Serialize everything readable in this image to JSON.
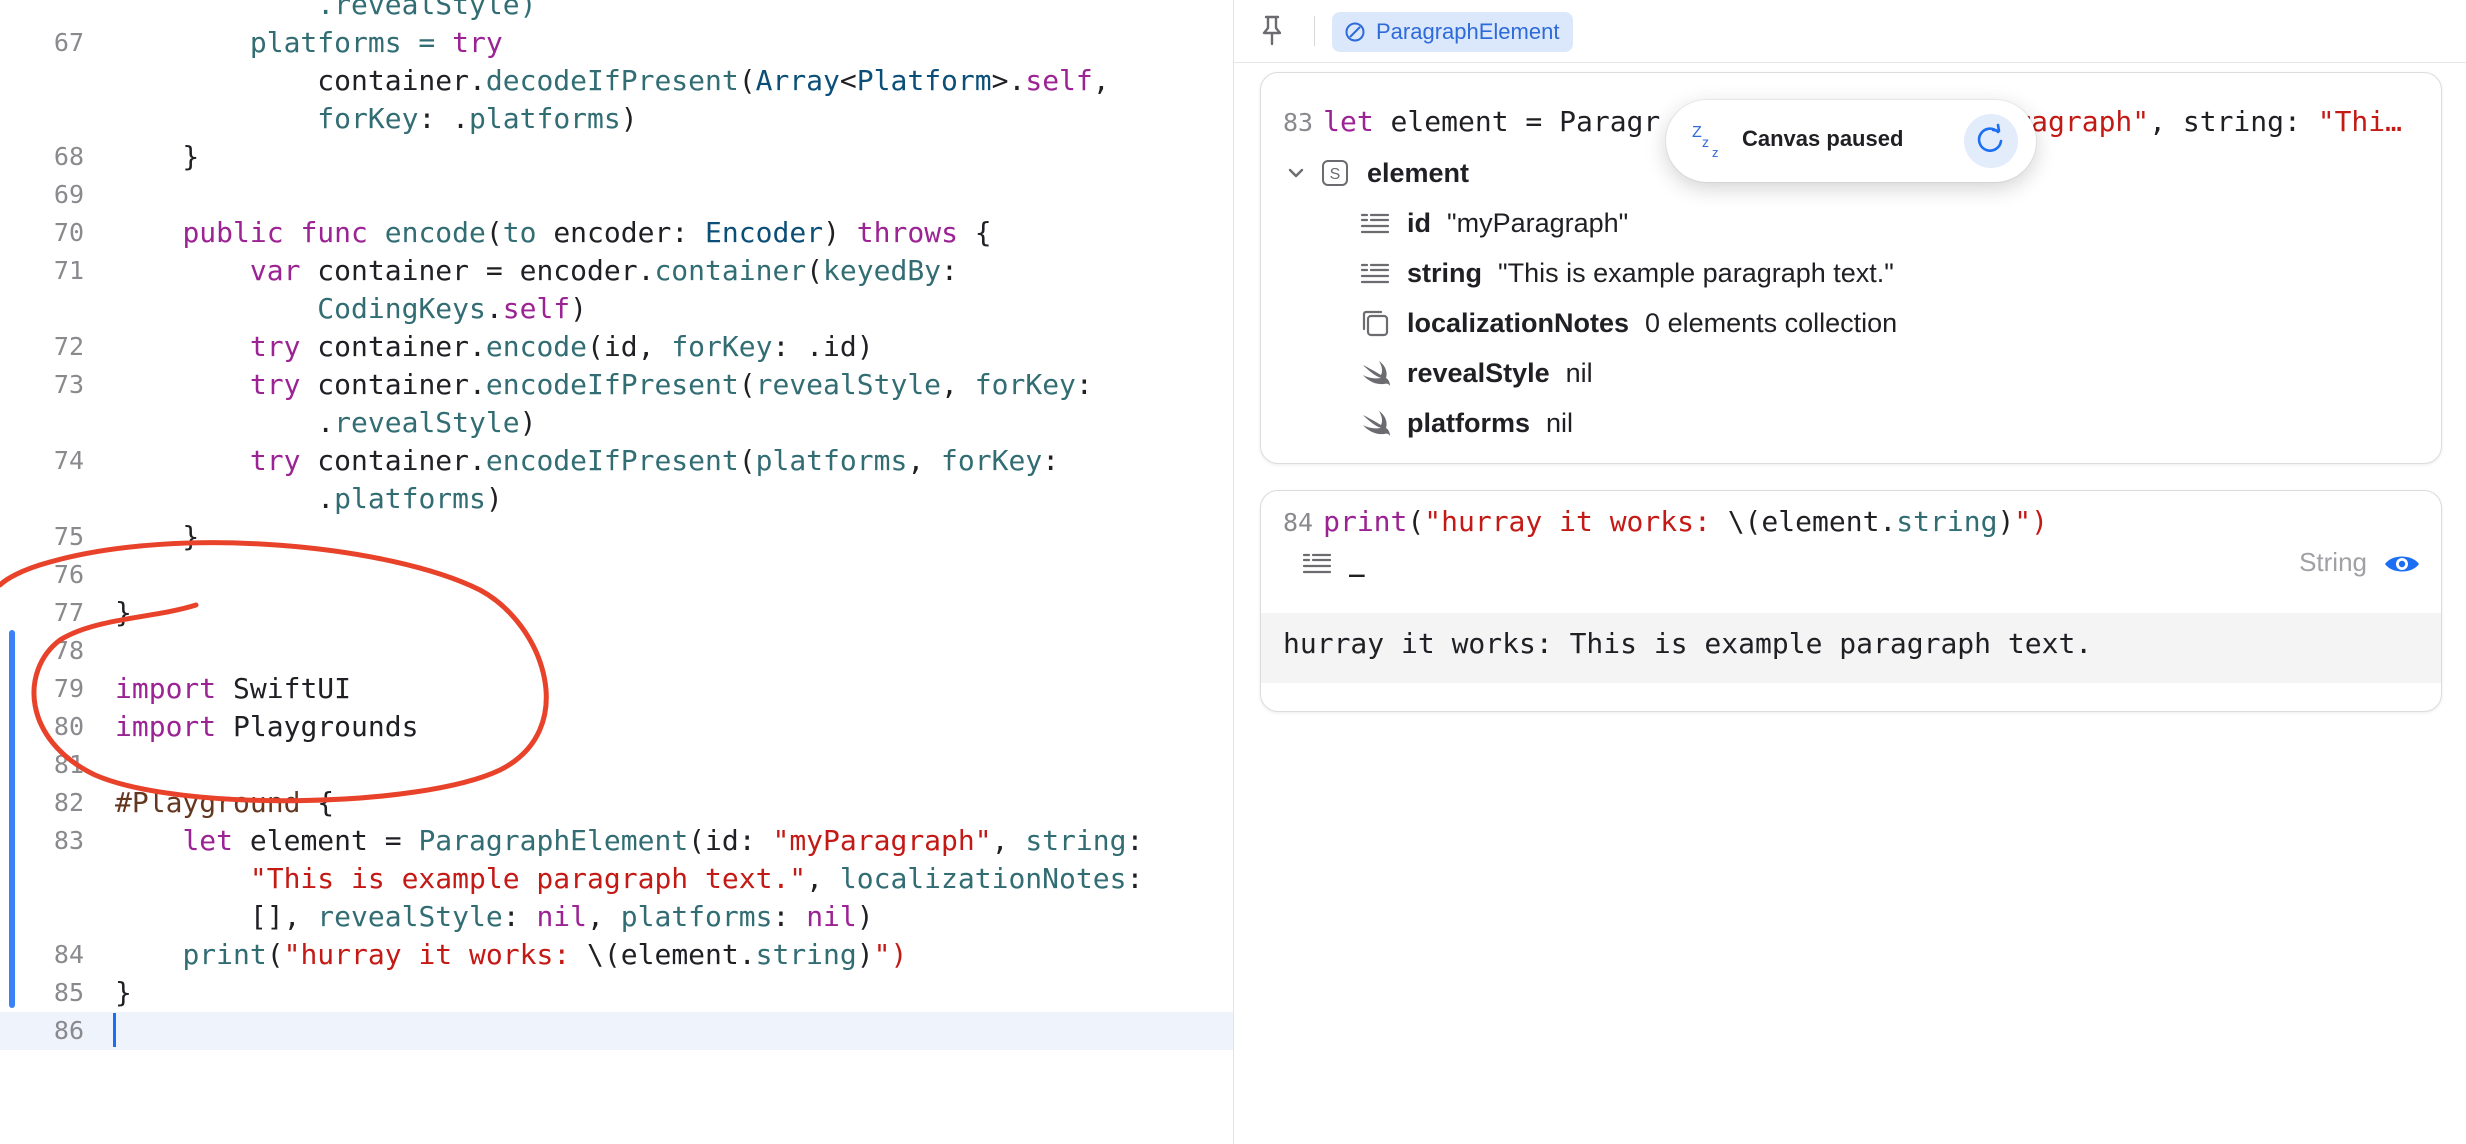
{
  "editor": {
    "lines": [
      {
        "num": "",
        "segs": [
          {
            "t": "            "
          },
          {
            "t": ".revealStyle)",
            "c": "fn"
          }
        ]
      },
      {
        "num": "67",
        "segs": [
          {
            "t": "        platforms = ",
            "c": "fn"
          },
          {
            "t": "try",
            "c": "kw"
          }
        ]
      },
      {
        "num": "",
        "segs": [
          {
            "t": "            container."
          },
          {
            "t": "decodeIfPresent",
            "c": "fn"
          },
          {
            "t": "("
          },
          {
            "t": "Array",
            "c": "typ"
          },
          {
            "t": "<"
          },
          {
            "t": "Platform",
            "c": "typ"
          },
          {
            "t": ">."
          },
          {
            "t": "self",
            "c": "kw"
          },
          {
            "t": ","
          }
        ]
      },
      {
        "num": "",
        "segs": [
          {
            "t": "            "
          },
          {
            "t": "forKey",
            "c": "fn"
          },
          {
            "t": ": ."
          },
          {
            "t": "platforms",
            "c": "fn"
          },
          {
            "t": ")"
          }
        ]
      },
      {
        "num": "68",
        "segs": [
          {
            "t": "    }"
          }
        ]
      },
      {
        "num": "69",
        "segs": []
      },
      {
        "num": "70",
        "segs": [
          {
            "t": "    "
          },
          {
            "t": "public func",
            "c": "kw"
          },
          {
            "t": " "
          },
          {
            "t": "encode",
            "c": "fn"
          },
          {
            "t": "("
          },
          {
            "t": "to",
            "c": "fn"
          },
          {
            "t": " encoder: "
          },
          {
            "t": "Encoder",
            "c": "typ"
          },
          {
            "t": ") "
          },
          {
            "t": "throws",
            "c": "kw"
          },
          {
            "t": " {"
          }
        ]
      },
      {
        "num": "71",
        "segs": [
          {
            "t": "        "
          },
          {
            "t": "var",
            "c": "kw"
          },
          {
            "t": " container = encoder."
          },
          {
            "t": "container",
            "c": "fn"
          },
          {
            "t": "("
          },
          {
            "t": "keyedBy",
            "c": "fn"
          },
          {
            "t": ":"
          }
        ]
      },
      {
        "num": "",
        "segs": [
          {
            "t": "            "
          },
          {
            "t": "CodingKeys",
            "c": "fn"
          },
          {
            "t": "."
          },
          {
            "t": "self",
            "c": "kw"
          },
          {
            "t": ")"
          }
        ]
      },
      {
        "num": "72",
        "segs": [
          {
            "t": "        "
          },
          {
            "t": "try",
            "c": "kw"
          },
          {
            "t": " container."
          },
          {
            "t": "encode",
            "c": "fn"
          },
          {
            "t": "(id, "
          },
          {
            "t": "forKey",
            "c": "fn"
          },
          {
            "t": ": .id)"
          }
        ]
      },
      {
        "num": "73",
        "segs": [
          {
            "t": "        "
          },
          {
            "t": "try",
            "c": "kw"
          },
          {
            "t": " container."
          },
          {
            "t": "encodeIfPresent",
            "c": "fn"
          },
          {
            "t": "("
          },
          {
            "t": "revealStyle",
            "c": "fn"
          },
          {
            "t": ", "
          },
          {
            "t": "forKey",
            "c": "fn"
          },
          {
            "t": ":"
          }
        ]
      },
      {
        "num": "",
        "segs": [
          {
            "t": "            ."
          },
          {
            "t": "revealStyle",
            "c": "fn"
          },
          {
            "t": ")"
          }
        ]
      },
      {
        "num": "74",
        "segs": [
          {
            "t": "        "
          },
          {
            "t": "try",
            "c": "kw"
          },
          {
            "t": " container."
          },
          {
            "t": "encodeIfPresent",
            "c": "fn"
          },
          {
            "t": "("
          },
          {
            "t": "platforms",
            "c": "fn"
          },
          {
            "t": ", "
          },
          {
            "t": "forKey",
            "c": "fn"
          },
          {
            "t": ":"
          }
        ]
      },
      {
        "num": "",
        "segs": [
          {
            "t": "            ."
          },
          {
            "t": "platforms",
            "c": "fn"
          },
          {
            "t": ")"
          }
        ]
      },
      {
        "num": "75",
        "segs": [
          {
            "t": "    }"
          }
        ]
      },
      {
        "num": "76",
        "segs": []
      },
      {
        "num": "77",
        "segs": [
          {
            "t": "}"
          }
        ]
      },
      {
        "num": "78",
        "segs": []
      },
      {
        "num": "79",
        "segs": [
          {
            "t": "import",
            "c": "kw"
          },
          {
            "t": " SwiftUI"
          }
        ]
      },
      {
        "num": "80",
        "segs": [
          {
            "t": "import",
            "c": "kw"
          },
          {
            "t": " Playgrounds"
          }
        ]
      },
      {
        "num": "81",
        "segs": []
      },
      {
        "num": "82",
        "segs": [
          {
            "t": "#Playground",
            "c": "mac"
          },
          {
            "t": " {"
          }
        ]
      },
      {
        "num": "83",
        "segs": [
          {
            "t": "    "
          },
          {
            "t": "let",
            "c": "kw"
          },
          {
            "t": " element = "
          },
          {
            "t": "ParagraphElement",
            "c": "fn"
          },
          {
            "t": "(id: "
          },
          {
            "t": "\"myParagraph\"",
            "c": "str"
          },
          {
            "t": ", "
          },
          {
            "t": "string",
            "c": "fn"
          },
          {
            "t": ":"
          }
        ]
      },
      {
        "num": "",
        "segs": [
          {
            "t": "        "
          },
          {
            "t": "\"This is example paragraph text.\"",
            "c": "str"
          },
          {
            "t": ", "
          },
          {
            "t": "localizationNotes",
            "c": "fn"
          },
          {
            "t": ":"
          }
        ]
      },
      {
        "num": "",
        "segs": [
          {
            "t": "        [], "
          },
          {
            "t": "revealStyle",
            "c": "fn"
          },
          {
            "t": ": "
          },
          {
            "t": "nil",
            "c": "kw"
          },
          {
            "t": ", "
          },
          {
            "t": "platforms",
            "c": "fn"
          },
          {
            "t": ": "
          },
          {
            "t": "nil",
            "c": "kw"
          },
          {
            "t": ")"
          }
        ]
      },
      {
        "num": "84",
        "segs": [
          {
            "t": "    "
          },
          {
            "t": "print",
            "c": "fn"
          },
          {
            "t": "("
          },
          {
            "t": "\"hurray it works: ",
            "c": "str"
          },
          {
            "t": "\\(element."
          },
          {
            "t": "string",
            "c": "fn"
          },
          {
            "t": ")"
          },
          {
            "t": "\")",
            "c": "str"
          }
        ]
      },
      {
        "num": "85",
        "segs": [
          {
            "t": "}"
          }
        ]
      },
      {
        "num": "86",
        "segs": [],
        "current": true
      }
    ]
  },
  "canvas": {
    "chip_label": "ParagraphElement",
    "paused_label": "Canvas paused",
    "card1": {
      "line_num": "83",
      "segs": [
        {
          "t": "let",
          "c": "kw"
        },
        {
          "t": " element = Paragr"
        },
        {
          "t": "                    "
        },
        {
          "t": "aragraph\"",
          "c": "str"
        },
        {
          "t": ", string: "
        },
        {
          "t": "\"Thi…",
          "c": "str"
        }
      ],
      "root_name": "element",
      "props": [
        {
          "name": "id",
          "value": "\"myParagraph\"",
          "icon": "text-quote-icon"
        },
        {
          "name": "string",
          "value": "\"This is example paragraph text.\"",
          "icon": "text-quote-icon"
        },
        {
          "name": "localizationNotes",
          "value": "0 elements collection",
          "icon": "collection-icon"
        },
        {
          "name": "revealStyle",
          "value": "nil",
          "icon": "swift-icon"
        },
        {
          "name": "platforms",
          "value": "nil",
          "icon": "swift-icon"
        }
      ]
    },
    "card2": {
      "line_num": "84",
      "segs": [
        {
          "t": "print",
          "c": "kw"
        },
        {
          "t": "("
        },
        {
          "t": "\"hurray it works: ",
          "c": "str"
        },
        {
          "t": "\\(element."
        },
        {
          "t": "string",
          "c": "fn"
        },
        {
          "t": ")"
        },
        {
          "t": "\")",
          "c": "str"
        }
      ],
      "value_placeholder": "_",
      "type_label": "String",
      "output": "hurray it works: This is example paragraph text."
    }
  },
  "colors": {
    "keyword": "#9b2393",
    "type": "#0b4f79",
    "function": "#326d74",
    "string": "#c41a16",
    "accent": "#1c6ef2",
    "annotation": "#e8432a"
  }
}
